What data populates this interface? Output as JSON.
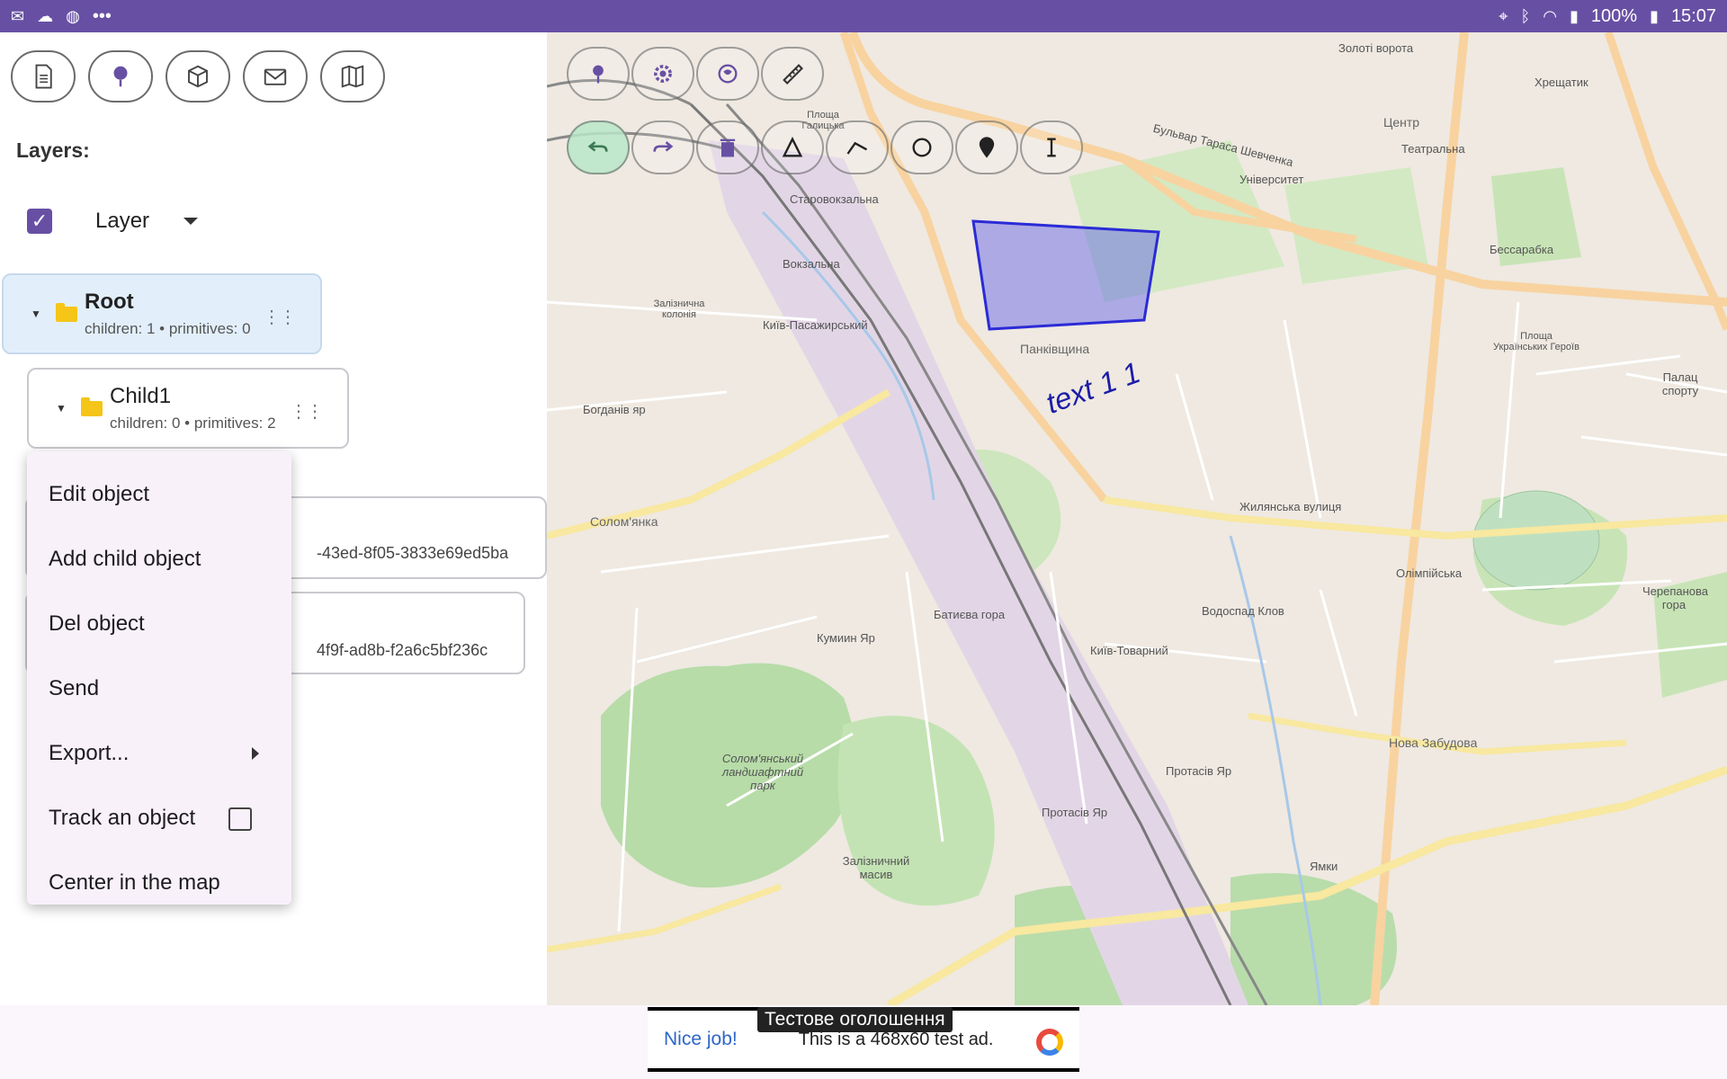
{
  "status_bar": {
    "battery": "100%",
    "time": "15:07",
    "more": "•••"
  },
  "toolbar": {
    "buttons": [
      {
        "name": "document"
      },
      {
        "name": "marker"
      },
      {
        "name": "cube"
      },
      {
        "name": "mail"
      },
      {
        "name": "map"
      }
    ]
  },
  "layers": {
    "label": "Layers:",
    "layer_name": "Layer",
    "checked": true
  },
  "tree": {
    "root": {
      "title": "Root",
      "subtitle": "children: 1 • primitives: 0"
    },
    "child": {
      "title": "Child1",
      "subtitle": "children: 0 • primitives: 2"
    },
    "items": [
      {
        "uuid": "-43ed-8f05-3833e69ed5ba"
      },
      {
        "uuid": "4f9f-ad8b-f2a6c5bf236c"
      }
    ]
  },
  "context_menu": {
    "items": [
      {
        "label": "Edit object"
      },
      {
        "label": "Add child object"
      },
      {
        "label": "Del object"
      },
      {
        "label": "Send"
      },
      {
        "label": "Export..."
      },
      {
        "label": "Track an object"
      },
      {
        "label": "Center in the map"
      }
    ]
  },
  "map": {
    "text_object": "text 1 1",
    "polygon_color": "#2b2bd6",
    "labels": [
      "Золоті ворота",
      "Центр",
      "Хрещатик",
      "Університет",
      "Театральна",
      "Бульвар Тараса Шевченка",
      "Бессарабка",
      "Вокзальна",
      "Київ-Пасажирський",
      "Старовокзальна",
      "Панківщина",
      "Жилянська вулиця",
      "Олімпійська",
      "Солом'янка",
      "Богданів яр",
      "Батиєва гора",
      "Київ-Товарний",
      "Водоспад Клов",
      "Нова Забудова",
      "Протасів Яр",
      "Солом'янський ландшафтний парк",
      "Залізничний масив",
      "Кумиин Яр",
      "Черепанова гора",
      "Палац спорту",
      "Площа Українських Героїв",
      "Протасів Яр",
      "Ямки",
      "Залізнична колонія",
      "Площа Галицька"
    ]
  },
  "ad": {
    "title": "Тестове оголошення",
    "nice": "Nice job!",
    "text": "This is a 468x60 test ad."
  }
}
